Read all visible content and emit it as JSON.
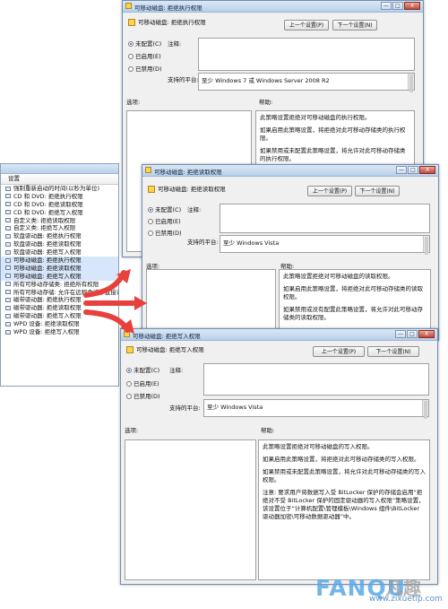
{
  "list_window": {
    "header": "设置",
    "items": [
      "强制重新启动的时间(以秒为单位)",
      "CD 和 DVD: 拒绝执行权限",
      "CD 和 DVD: 拒绝读取权限",
      "CD 和 DVD: 拒绝写入权限",
      "自定义类: 拒绝读取权限",
      "自定义类: 拒绝写入权限",
      "软盘驱动器: 拒绝执行权限",
      "软盘驱动器: 拒绝读取权限",
      "软盘驱动器: 拒绝写入权限",
      "可移动磁盘: 拒绝执行权限",
      "可移动磁盘: 拒绝读取权限",
      "可移动磁盘: 拒绝写入权限",
      "所有可移动存储类: 拒绝所有权限",
      "所有可移动存储: 允许在远程会话中直接访问",
      "磁带驱动器: 拒绝执行权限",
      "磁带驱动器: 拒绝读取权限",
      "磁带驱动器: 拒绝写入权限",
      "WPD 设备: 拒绝读取权限",
      "WPD 设备: 拒绝写入权限"
    ]
  },
  "common": {
    "prev": "上一个设置(P)",
    "next": "下一个设置(N)",
    "not_configured": "未配置(C)",
    "enabled": "已启用(E)",
    "disabled": "已禁用(D)",
    "comment": "注释:",
    "supported_on": "支持的平台:",
    "options": "选项:",
    "help": "帮助:",
    "min": "—",
    "max": "□",
    "close": "X"
  },
  "win1": {
    "title": "可移动磁盘: 拒绝执行权限",
    "heading": "可移动磁盘: 拒绝执行权限",
    "platform": "至少 Windows 7 或 Windows Server 2008 R2",
    "help": [
      "此策略设置拒绝对可移动磁盘的执行权限。",
      "如果启用此策略设置，将拒绝对此可移动存储类的执行权限。",
      "如果禁用或未配置此策略设置，将允许对此可移动存储类的执行权限。"
    ]
  },
  "win2": {
    "title": "可移动磁盘: 拒绝读取权限",
    "heading": "可移动磁盘: 拒绝读取权限",
    "platform": "至少 Windows Vista",
    "help": [
      "此策略设置拒绝对可移动磁盘的读取权限。",
      "如果启用此策略设置，将拒绝对此可移动存储类的读取权限。",
      "如果禁用或没有配置此策略设置，将允许对此可移动存储类的读取权限。"
    ]
  },
  "win3": {
    "title": "可移动磁盘: 拒绝写入权限",
    "heading": "可移动磁盘: 拒绝写入权限",
    "platform": "至少 Windows Vista",
    "help": [
      "此策略设置拒绝对可移动磁盘的写入权限。",
      "如果启用此策略设置，将拒绝对此可移动存储类的写入权限。",
      "如果禁用或未配置此策略设置，将允许对此可移动存储类的写入权限。",
      "注意: 要求用户将数据写入受 BitLocker 保护的存储会启用“拒绝对不受 BitLocker 保护的固定驱动器的写入权限”策略设置，该设置位于“计算机配置\\管理模板\\Windows 组件\\BitLocker 驱动器加密\\可移动数据驱动器”中。"
    ]
  },
  "watermark": {
    "brand": "FANQU",
    "cn": "凡趣",
    "url": "www.zixuetip.com"
  },
  "colors": {
    "arrow": "#e8403a"
  }
}
